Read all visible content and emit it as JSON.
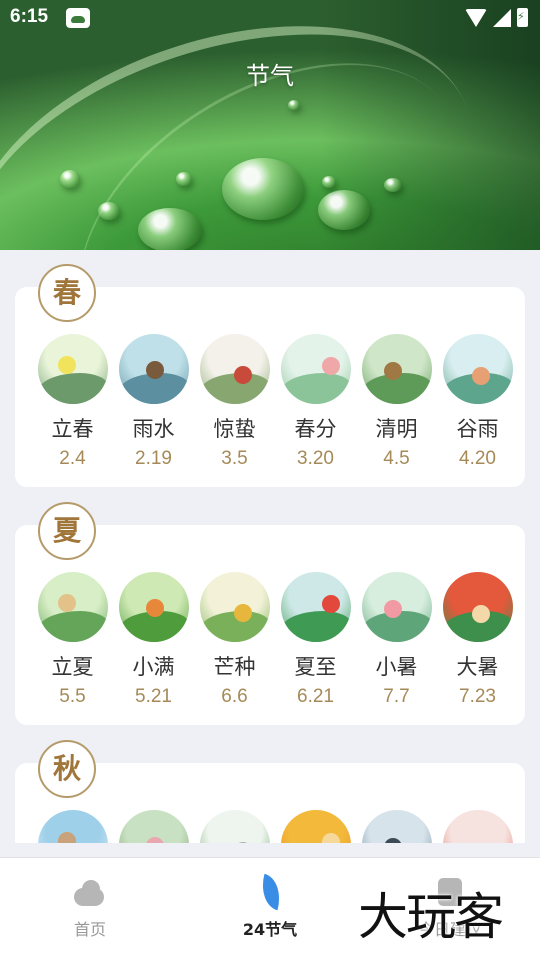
{
  "status_bar": {
    "time": "6:15"
  },
  "header": {
    "title": "节气"
  },
  "seasons": [
    {
      "name": "春",
      "terms": [
        {
          "name": "立春",
          "date": "2.4",
          "colors": [
            "#e9f4d9",
            "#6c9a6a",
            "#f2e35c"
          ]
        },
        {
          "name": "雨水",
          "date": "2.19",
          "colors": [
            "#bfe0e8",
            "#5c8fa0",
            "#7a5a3c"
          ]
        },
        {
          "name": "惊蛰",
          "date": "3.5",
          "colors": [
            "#f4f1ea",
            "#88a770",
            "#c84a3a"
          ]
        },
        {
          "name": "春分",
          "date": "3.20",
          "colors": [
            "#e4f3ea",
            "#8cc49a",
            "#f0a7a7"
          ]
        },
        {
          "name": "清明",
          "date": "4.5",
          "colors": [
            "#cfe6c8",
            "#5e9a58",
            "#a07844"
          ]
        },
        {
          "name": "谷雨",
          "date": "4.20",
          "colors": [
            "#d9eef0",
            "#5ea58e",
            "#e79f74"
          ]
        }
      ]
    },
    {
      "name": "夏",
      "terms": [
        {
          "name": "立夏",
          "date": "5.5",
          "colors": [
            "#d8eec6",
            "#64a55a",
            "#e3c28a"
          ]
        },
        {
          "name": "小满",
          "date": "5.21",
          "colors": [
            "#cfe9b4",
            "#4f9c3c",
            "#e6873a"
          ]
        },
        {
          "name": "芒种",
          "date": "6.6",
          "colors": [
            "#f3f2d8",
            "#7ab05a",
            "#e7b63c"
          ]
        },
        {
          "name": "夏至",
          "date": "6.21",
          "colors": [
            "#cde8e6",
            "#3f9a54",
            "#e2483c"
          ]
        },
        {
          "name": "小暑",
          "date": "7.7",
          "colors": [
            "#d7eedf",
            "#5fa57a",
            "#f19aa4"
          ]
        },
        {
          "name": "大暑",
          "date": "7.23",
          "colors": [
            "#e4583c",
            "#3f8f4c",
            "#f5d8a8"
          ]
        }
      ]
    },
    {
      "name": "秋",
      "terms": [
        {
          "colors": [
            "#9fd0ea",
            "#e9f4f8",
            "#c8a27a"
          ]
        },
        {
          "colors": [
            "#c9e1c3",
            "#6a9a5a",
            "#e9a7b0"
          ]
        },
        {
          "colors": [
            "#eef5ee",
            "#5e9a58",
            "#b0b0b0"
          ]
        },
        {
          "colors": [
            "#f2b93a",
            "#e88a2a",
            "#f5d89a"
          ]
        },
        {
          "colors": [
            "#d7e3ea",
            "#5a7d8f",
            "#3c4c56"
          ]
        },
        {
          "colors": [
            "#f6e3e0",
            "#e06a5a",
            "#b24a3c"
          ]
        }
      ]
    }
  ],
  "bottom_nav": [
    {
      "label": "首页",
      "icon": "cloud-sun-icon",
      "active": false
    },
    {
      "label": "24节气",
      "icon": "leaf-icon",
      "active": true
    },
    {
      "label": "今日建议",
      "icon": "advice-icon",
      "active": false
    }
  ],
  "watermark": "大玩客"
}
